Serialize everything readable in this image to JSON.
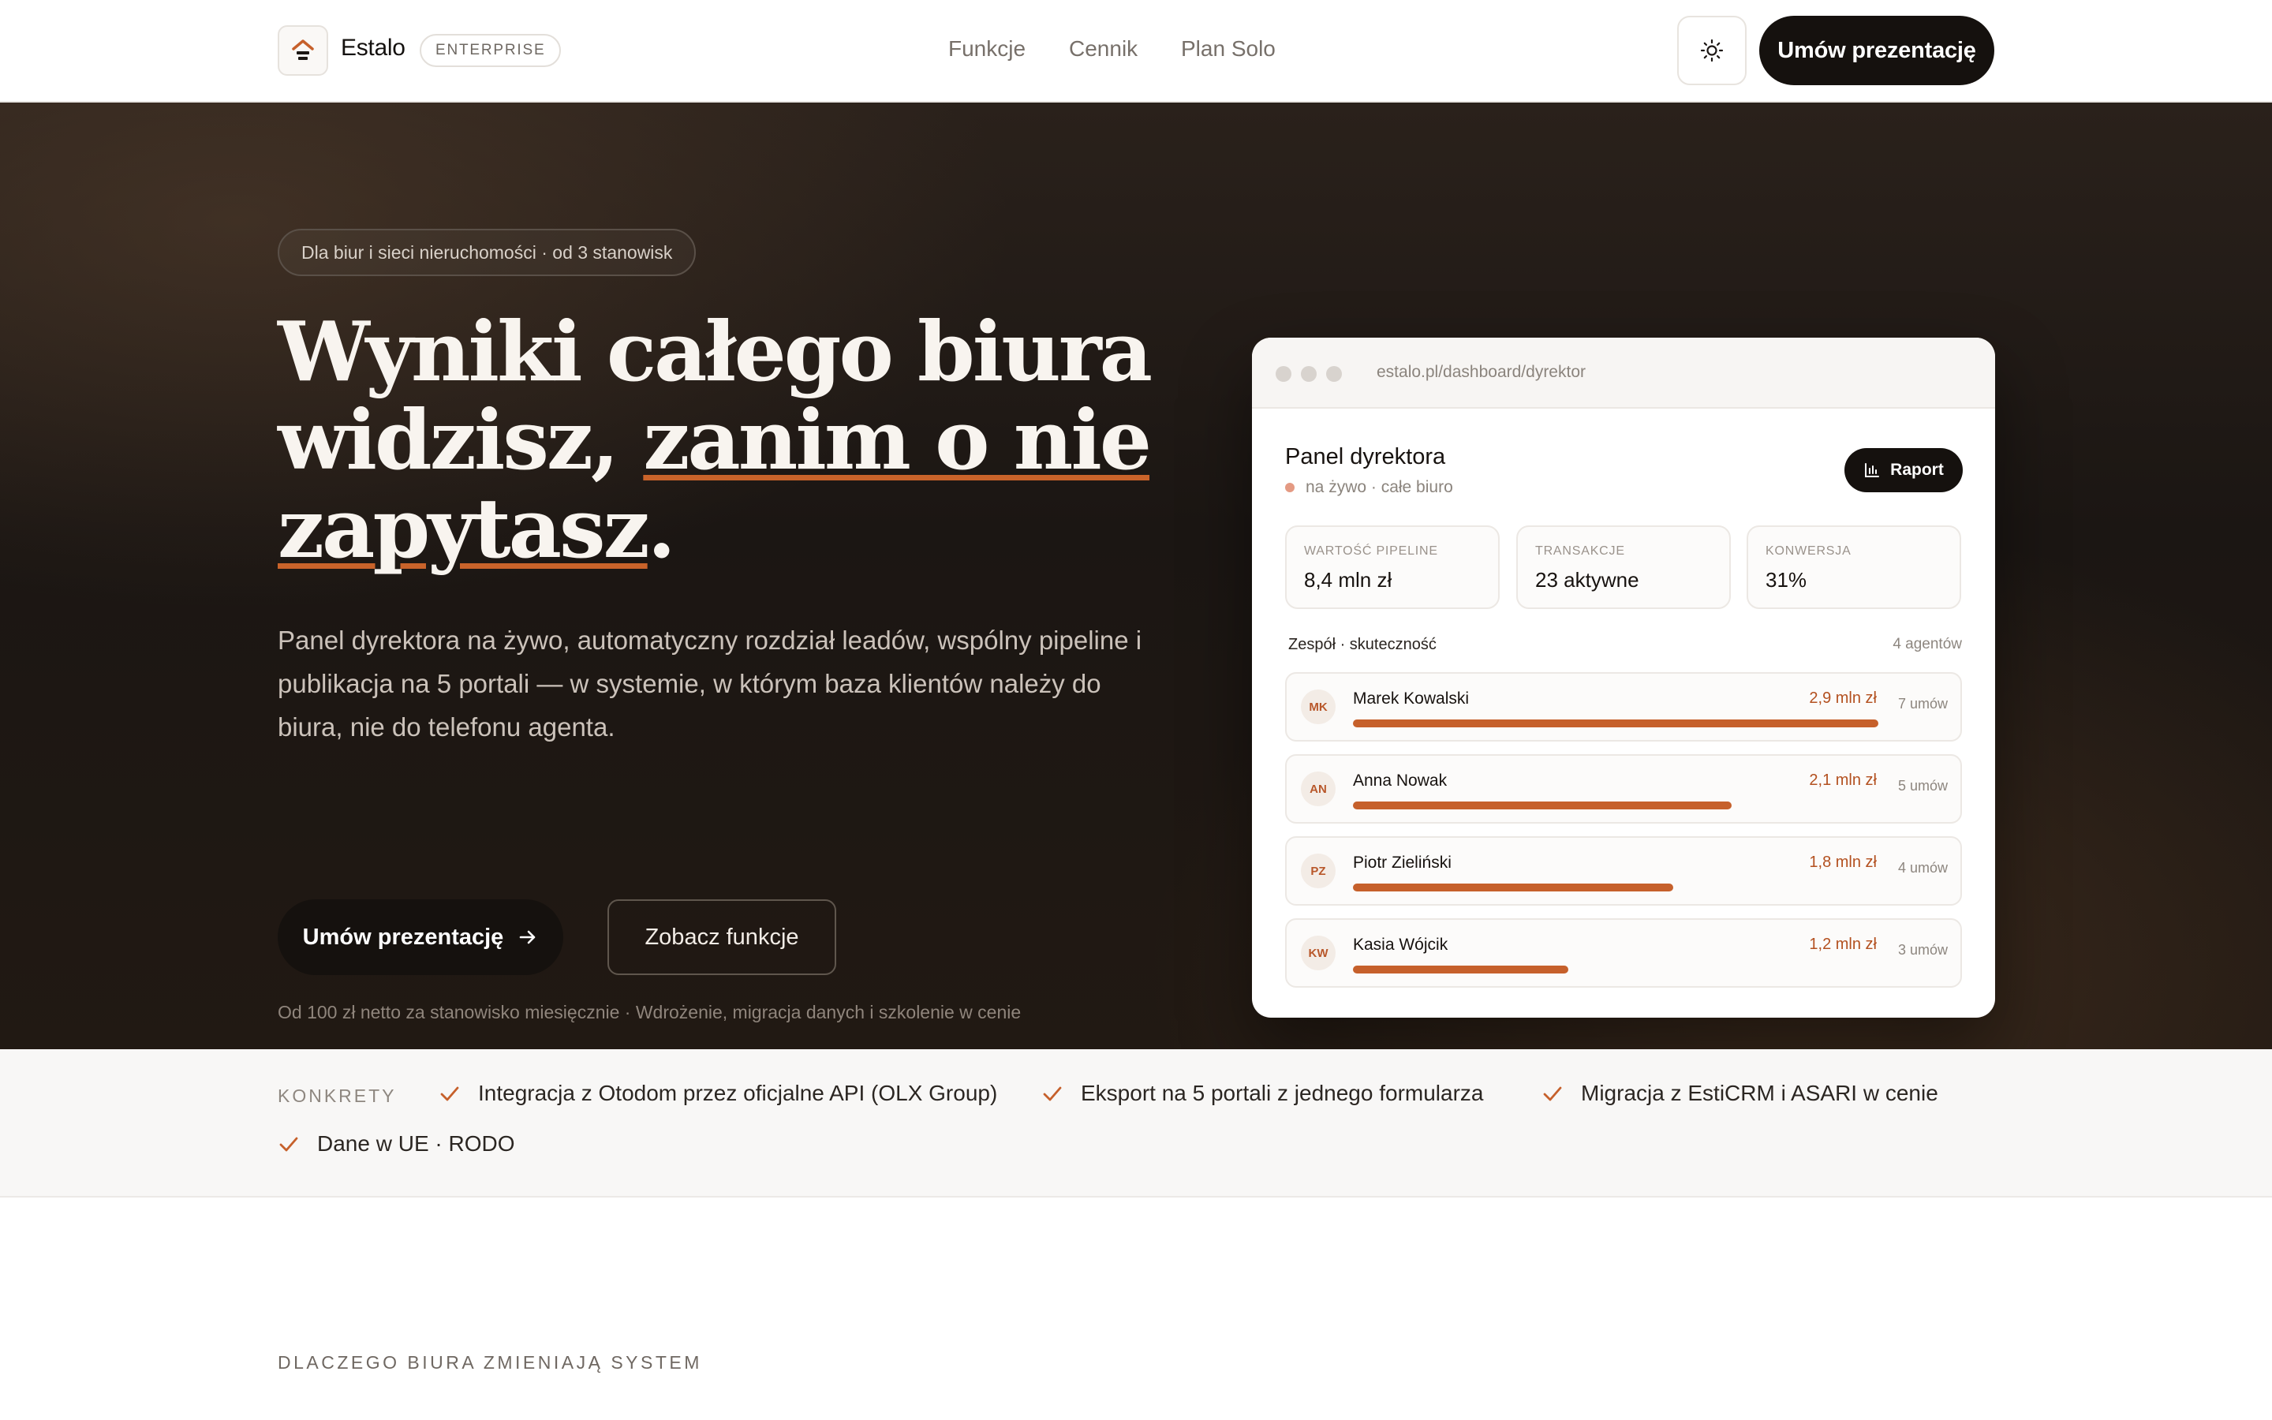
{
  "nav": {
    "brand": "Estalo",
    "badge": "ENTERPRISE",
    "links": [
      "Funkcje",
      "Cennik",
      "Plan Solo"
    ],
    "cta": "Umów prezentację"
  },
  "hero": {
    "pill": "Dla biur i sieci nieruchomości · od 3 stanowisk",
    "title": {
      "line1": "Wyniki całego biura",
      "line2_plain": "widzisz, ",
      "line2_underlined": "zanim o nie",
      "line3_underlined": "zapytasz",
      "line3_end": "."
    },
    "description": "Panel dyrektora na żywo, automatyczny rozdział leadów, wspólny pipeline i publikacja na 5 portali — w systemie, w którym baza klientów należy do biura, nie do telefonu agenta.",
    "primary_cta": "Umów prezentację",
    "secondary_cta": "Zobacz funkcje",
    "note": "Od 100 zł netto za stanowisko miesięcznie · Wdrożenie, migracja danych i szkolenie w cenie"
  },
  "dashboard": {
    "url": "estalo.pl/dashboard/dyrektor",
    "title": "Panel dyrektora",
    "subtitle": "na żywo · całe biuro",
    "report_button": "Raport",
    "stats": [
      {
        "label": "WARTOŚĆ PIPELINE",
        "value": "8,4 mln zł"
      },
      {
        "label": "TRANSAKCJE",
        "value": "23 aktywne"
      },
      {
        "label": "KONWERSJA",
        "value": "31%"
      }
    ],
    "team_heading": "Zespół · skuteczność",
    "team_count": "4 agentów",
    "agents": [
      {
        "initials": "MK",
        "name": "Marek Kowalski",
        "amount": "2,9 mln zł",
        "deals": "7 umów",
        "progress": 1.0
      },
      {
        "initials": "AN",
        "name": "Anna Nowak",
        "amount": "2,1 mln zł",
        "deals": "5 umów",
        "progress": 0.72
      },
      {
        "initials": "PZ",
        "name": "Piotr Zieliński",
        "amount": "1,8 mln zł",
        "deals": "4 umów",
        "progress": 0.61
      },
      {
        "initials": "KW",
        "name": "Kasia Wójcik",
        "amount": "1,2 mln zł",
        "deals": "3 umów",
        "progress": 0.41
      }
    ]
  },
  "strip": {
    "label": "KONKRETY",
    "items": [
      "Integracja z Otodom przez oficjalne API (OLX Group)",
      "Eksport na 5 portali z jednego formularza",
      "Migracja z EstiCRM i ASARI w cenie",
      "Dane w UE · RODO"
    ]
  },
  "why": {
    "eyebrow": "DLACZEGO BIURA ZMIENIAJĄ SYSTEM"
  },
  "colors": {
    "accent": "#c6602b",
    "dark": "#15110e"
  }
}
